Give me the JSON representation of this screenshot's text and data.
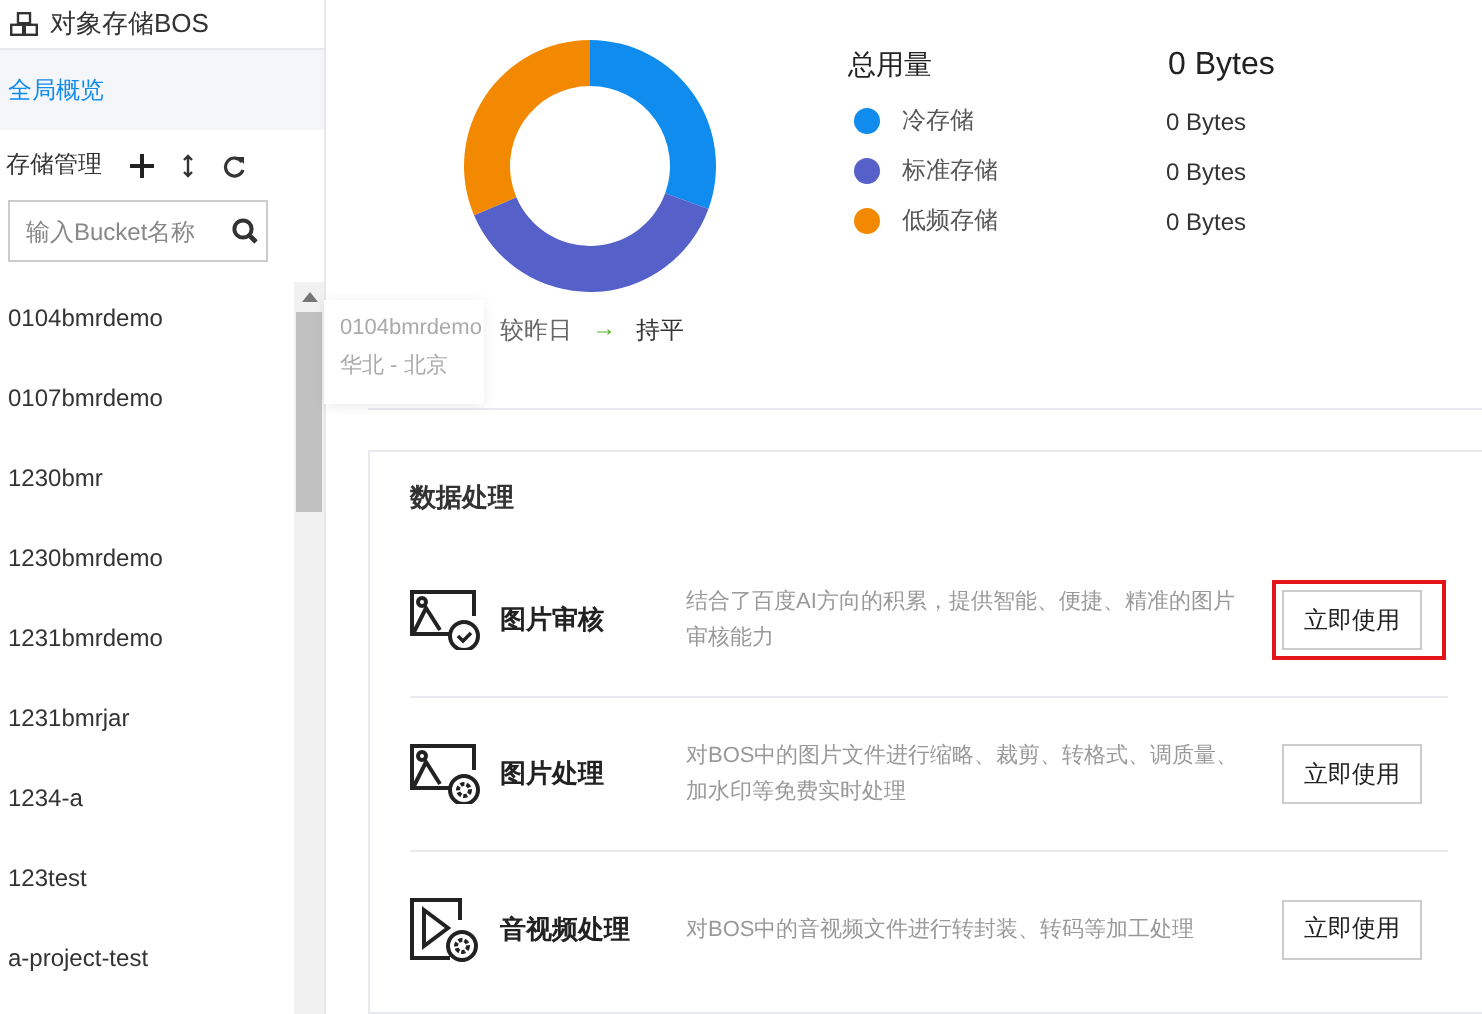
{
  "sidebar": {
    "title": "对象存储BOS",
    "overview": {
      "label": "全局概览",
      "selected": true
    },
    "section_label": "存储管理",
    "search": {
      "placeholder": "输入Bucket名称"
    },
    "buckets": [
      "0104bmrdemo",
      "0107bmrdemo",
      "1230bmr",
      "1230bmrdemo",
      "1231bmrdemo",
      "1231bmrjar",
      "1234-a",
      "123test",
      "a-project-test"
    ]
  },
  "tooltip": {
    "name": "0104bmrdemo",
    "region": "华北 - 北京"
  },
  "usage": {
    "total_label": "总用量",
    "total_value": "0 Bytes",
    "classes": [
      {
        "label": "冷存储",
        "value": "0 Bytes",
        "color": "#108cee"
      },
      {
        "label": "标准存储",
        "value": "0 Bytes",
        "color": "#5560c8"
      },
      {
        "label": "低频存储",
        "value": "0 Bytes",
        "color": "#f38900"
      }
    ],
    "trend": {
      "label": "较昨日",
      "arrow": "→",
      "value": "持平"
    }
  },
  "data_processing": {
    "title": "数据处理",
    "services": [
      {
        "kind": "image-check",
        "name": "图片审核",
        "description": "结合了百度AI方向的积累，提供智能、便捷、精准的图片审核能力",
        "button": "立即使用",
        "highlighted": true
      },
      {
        "kind": "image-gear",
        "name": "图片处理",
        "description": "对BOS中的图片文件进行缩略、裁剪、转格式、调质量、加水印等免费实时处理",
        "button": "立即使用",
        "highlighted": false
      },
      {
        "kind": "video-gear",
        "name": "音视频处理",
        "description": "对BOS中的音视频文件进行转封装、转码等加工处理",
        "button": "立即使用",
        "highlighted": false
      }
    ]
  }
}
